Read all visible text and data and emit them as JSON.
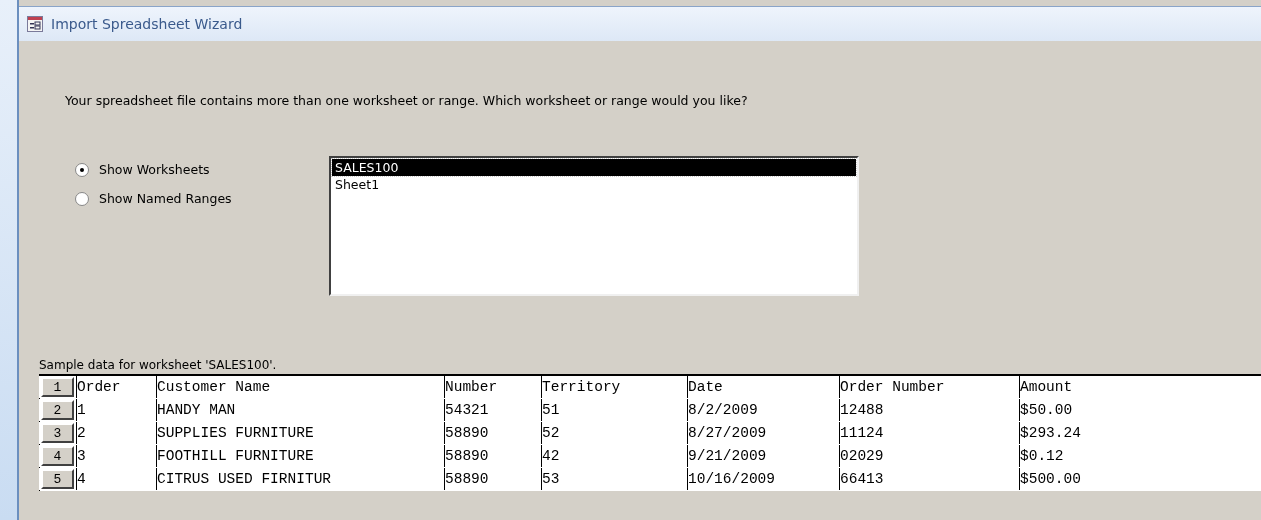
{
  "window": {
    "title": "Import Spreadsheet Wizard"
  },
  "prompt": "Your spreadsheet file contains more than one worksheet or range. Which worksheet or range would you like?",
  "options": [
    {
      "label": "Show Worksheets",
      "selected": true
    },
    {
      "label": "Show Named Ranges",
      "selected": false
    }
  ],
  "sheets": [
    {
      "label": "SALES100",
      "selected": true
    },
    {
      "label": "Sheet1",
      "selected": false
    }
  ],
  "sample_label": "Sample data for worksheet 'SALES100'.",
  "table": {
    "rows": [
      {
        "number": "1",
        "cells": [
          "Order",
          "Customer Name",
          "Number",
          "Territory",
          "Date",
          "Order Number",
          "Amount"
        ]
      },
      {
        "number": "2",
        "cells": [
          "1",
          "HANDY MAN",
          "54321",
          "51",
          "8/2/2009",
          "12488",
          "$50.00"
        ]
      },
      {
        "number": "3",
        "cells": [
          "2",
          "SUPPLIES FURNITURE",
          "58890",
          "52",
          "8/27/2009",
          "11124",
          "$293.24"
        ]
      },
      {
        "number": "4",
        "cells": [
          "3",
          "FOOTHILL FURNITURE",
          "58890",
          "42",
          "9/21/2009",
          "02029",
          "$0.12"
        ]
      },
      {
        "number": "5",
        "cells": [
          "4",
          "CITRUS USED FIRNITUR",
          "58890",
          "53",
          "10/16/2009",
          "66413",
          "$500.00"
        ]
      }
    ]
  }
}
